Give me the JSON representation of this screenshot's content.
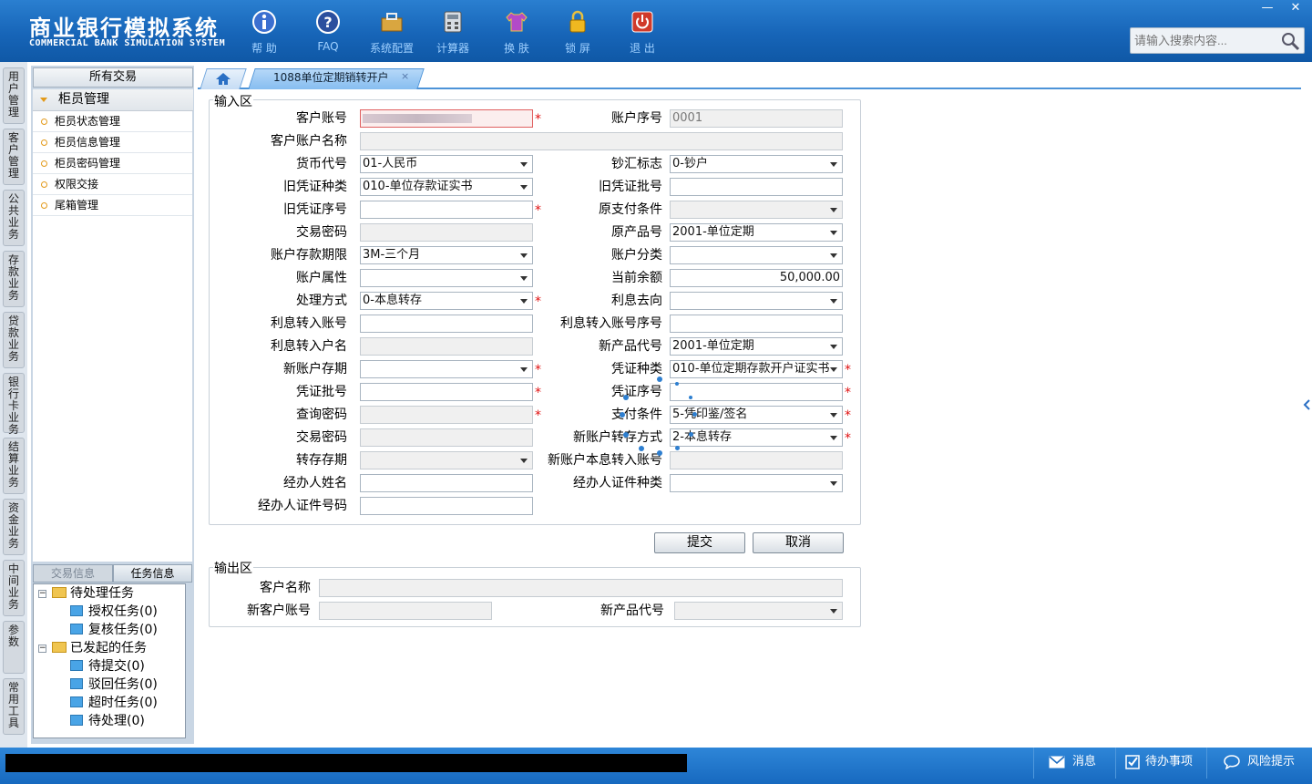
{
  "app": {
    "title_cn": "商业银行模拟系统",
    "title_en": "COMMERCIAL BANK SIMULATION SYSTEM"
  },
  "toolbar": [
    {
      "label": "帮 助",
      "icon": "info-icon"
    },
    {
      "label": "FAQ",
      "icon": "help-icon"
    },
    {
      "label": "系统配置",
      "icon": "toolbox-icon"
    },
    {
      "label": "计算器",
      "icon": "calculator-icon"
    },
    {
      "label": "换 肤",
      "icon": "shirt-icon"
    },
    {
      "label": "锁 屏",
      "icon": "lock-icon"
    },
    {
      "label": "退 出",
      "icon": "power-icon"
    }
  ],
  "window": {
    "minimize": "—",
    "close": "✕"
  },
  "search": {
    "placeholder": "请输入搜索内容..."
  },
  "left_tabs": [
    "用户管理",
    "客户管理",
    "公共业务",
    "存款业务",
    "贷款业务",
    "银行卡业务",
    "结算业务",
    "资金业务",
    "中间业务",
    "参数",
    "常用工具"
  ],
  "sidebar": {
    "header": "所有交易",
    "group": "柜员管理",
    "items": [
      "柜员状态管理",
      "柜员信息管理",
      "柜员密码管理",
      "权限交接",
      "尾箱管理"
    ],
    "bottom_tabs": [
      "交易信息",
      "任务信息"
    ],
    "tree": {
      "pending": "待处理任务",
      "auth": "授权任务(0)",
      "review": "复核任务(0)",
      "initiated": "已发起的任务",
      "to_submit": "待提交(0)",
      "rejected": "驳回任务(0)",
      "timeout": "超时任务(0)",
      "to_process": "待处理(0)"
    }
  },
  "tabs": {
    "active": "1088单位定期销转开户",
    "close": "×"
  },
  "input_area": {
    "legend": "输入区",
    "labels": {
      "cust_acct": "客户账号",
      "acct_seq": "账户序号",
      "cust_acct_name": "客户账户名称",
      "currency": "货币代号",
      "cash_flag": "钞汇标志",
      "old_voucher_type": "旧凭证种类",
      "old_voucher_batch": "旧凭证批号",
      "old_voucher_seq": "旧凭证序号",
      "orig_pay_cond": "原支付条件",
      "tx_pwd": "交易密码",
      "orig_product": "原产品号",
      "deposit_term": "账户存款期限",
      "acct_class": "账户分类",
      "acct_attr": "账户属性",
      "cur_balance": "当前余额",
      "process_mode": "处理方式",
      "interest_dest": "利息去向",
      "int_in_acct": "利息转入账号",
      "int_in_acct_seq": "利息转入账号序号",
      "int_in_name": "利息转入户名",
      "new_product": "新产品代号",
      "new_term": "新账户存期",
      "voucher_type": "凭证种类",
      "voucher_batch": "凭证批号",
      "voucher_seq": "凭证序号",
      "query_pwd": "查询密码",
      "pay_cond": "支付条件",
      "tx_pwd2": "交易密码",
      "new_transfer_mode": "新账户转存方式",
      "transfer_term": "转存存期",
      "new_int_acct": "新账户本息转入账号",
      "agent_name": "经办人姓名",
      "agent_id_type": "经办人证件种类",
      "agent_id_no": "经办人证件号码"
    },
    "values": {
      "acct_seq": "0001",
      "currency": "01-人民币",
      "cash_flag": "0-钞户",
      "old_voucher_type": "010-单位存款证实书",
      "orig_product": "2001-单位定期",
      "deposit_term": "3M-三个月",
      "cur_balance": "50,000.00",
      "process_mode": "0-本息转存",
      "new_product": "2001-单位定期",
      "voucher_type": "010-单位定期存款开户证实书",
      "pay_cond": "5-凭印鉴/签名",
      "new_transfer_mode": "2-本息转存"
    },
    "required_mark": "*"
  },
  "buttons": {
    "submit": "提交",
    "cancel": "取消"
  },
  "output_area": {
    "legend": "输出区",
    "cust_name": "客户名称",
    "new_cust_acct": "新客户账号",
    "new_product": "新产品代号"
  },
  "footer": {
    "message": "消息",
    "todo": "待办事项",
    "risk": "风险提示"
  },
  "colors": {
    "header": "#1765b8",
    "accent": "#4c93d8",
    "required": "#e01010"
  }
}
